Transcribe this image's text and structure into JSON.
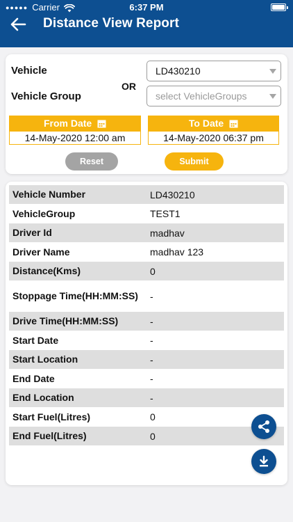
{
  "status_bar": {
    "carrier": "Carrier",
    "time": "6:37 PM"
  },
  "header": {
    "title": "Distance View Report",
    "color": "#0d4f91"
  },
  "filters": {
    "vehicle_label": "Vehicle",
    "vehicle_group_label": "Vehicle Group",
    "or_label": "OR",
    "vehicle_value": "LD430210",
    "vehicle_group_placeholder": "select VehicleGroups",
    "from_date_label": "From Date",
    "to_date_label": "To Date",
    "from_date_value": "14-May-2020 12:00 am",
    "to_date_value": "14-May-2020 06:37 pm",
    "reset_label": "Reset",
    "submit_label": "Submit",
    "accent_color": "#f6b40e"
  },
  "report": {
    "rows": [
      {
        "label": "Vehicle Number",
        "value": "LD430210"
      },
      {
        "label": "VehicleGroup",
        "value": "TEST1"
      },
      {
        "label": "Driver Id",
        "value": "madhav"
      },
      {
        "label": "Driver Name",
        "value": "madhav 123"
      },
      {
        "label": "Distance(Kms)",
        "value": "0"
      },
      {
        "label": "Stoppage Time(HH:MM:SS)",
        "value": "-"
      },
      {
        "label": "Drive Time(HH:MM:SS)",
        "value": "-"
      },
      {
        "label": "Start Date",
        "value": "-"
      },
      {
        "label": "Start Location",
        "value": "-"
      },
      {
        "label": "End Date",
        "value": "-"
      },
      {
        "label": "End Location",
        "value": "-"
      },
      {
        "label": "Start Fuel(Litres)",
        "value": "0"
      },
      {
        "label": "End Fuel(Litres)",
        "value": "0"
      }
    ]
  },
  "actions": {
    "share_icon": "share-icon",
    "download_icon": "download-icon"
  }
}
